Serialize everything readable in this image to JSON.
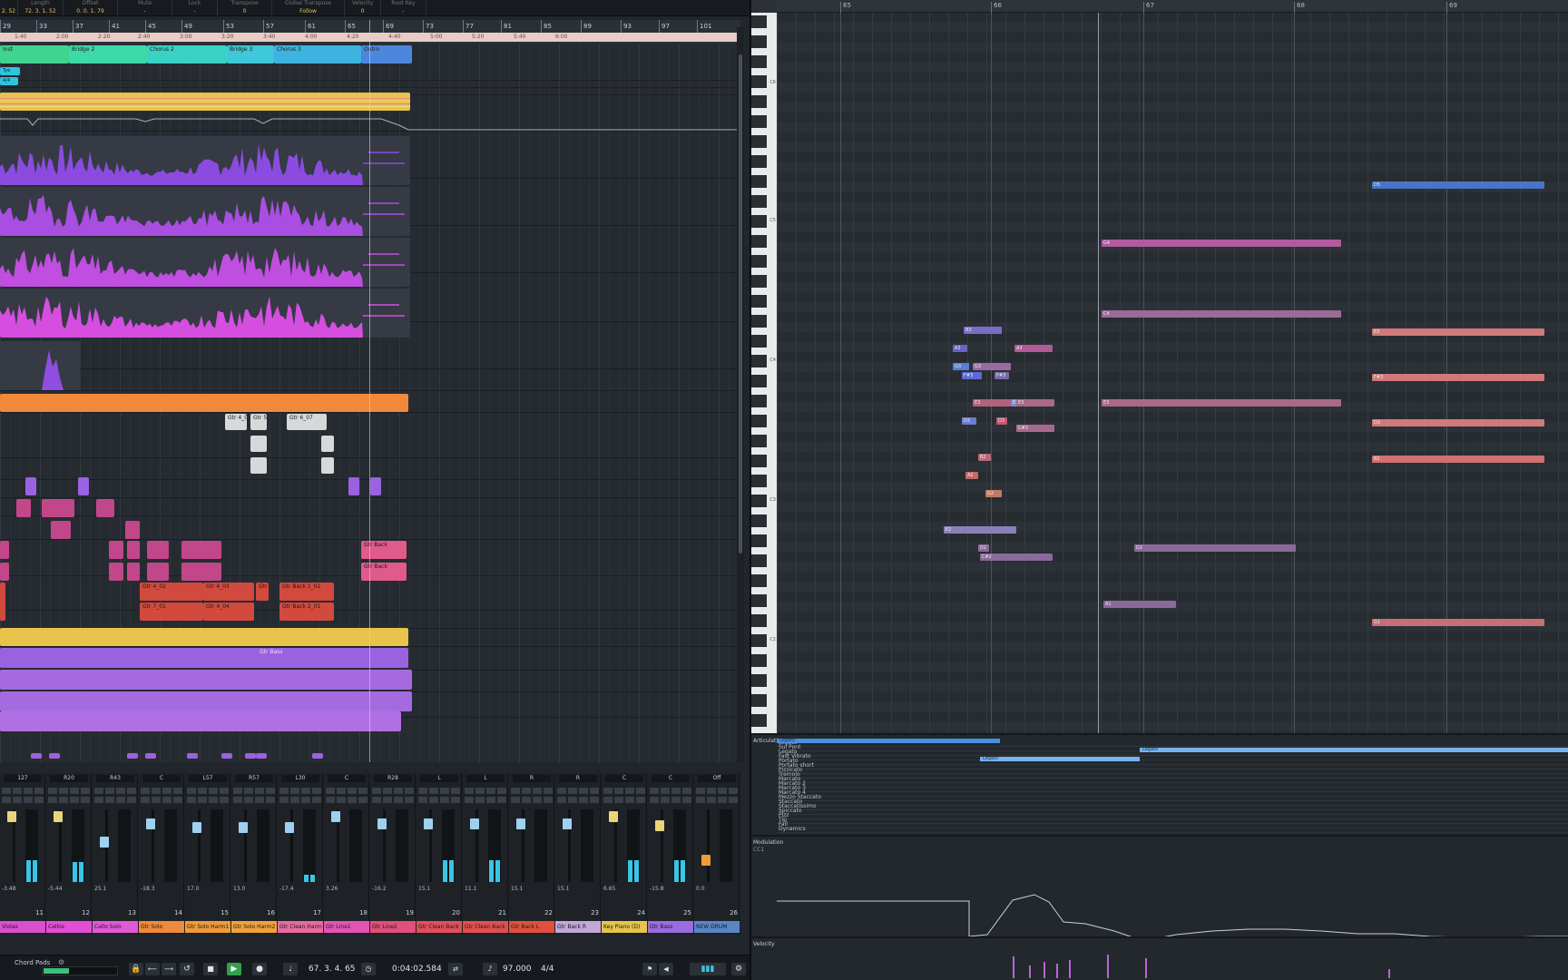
{
  "info_line": [
    {
      "label": "",
      "value": "2. 52"
    },
    {
      "label": "Length",
      "value": "72. 3. 1. 52"
    },
    {
      "label": "Offset",
      "value": "0. 0. 1. 79"
    },
    {
      "label": "Mute",
      "value": "-"
    },
    {
      "label": "Lock",
      "value": "-"
    },
    {
      "label": "Transpose",
      "value": "0"
    },
    {
      "label": "Global Transpose",
      "value": "Follow"
    },
    {
      "label": "Velocity",
      "value": "0"
    },
    {
      "label": "Root Key",
      "value": "-"
    }
  ],
  "ruler": {
    "bars": [
      "29",
      "33",
      "37",
      "41",
      "45",
      "49",
      "53",
      "57",
      "61",
      "65",
      "69",
      "73",
      "77",
      "81",
      "85",
      "89",
      "93",
      "97",
      "101"
    ],
    "times": [
      "1:40",
      "2:00",
      "2:20",
      "2:40",
      "3:00",
      "3:20",
      "3:40",
      "4:00",
      "4:20",
      "4:40",
      "5:00",
      "5:20",
      "5:40",
      "6:00"
    ]
  },
  "markers": [
    {
      "label": "Inst",
      "color": "#3fd58e"
    },
    {
      "label": "Bridge 2",
      "color": "#3dd9a7"
    },
    {
      "label": "Chorus 2",
      "color": "#39d2c4"
    },
    {
      "label": "Bridge 3",
      "color": "#3ec8d9"
    },
    {
      "label": "Chorus 3",
      "color": "#3eb3e0"
    },
    {
      "label": "Outro",
      "color": "#4d86dd"
    }
  ],
  "arrange_parts": {
    "small_tags": [
      "Tye",
      "4/4"
    ],
    "guitar_parts": [
      "Gtr 4_01",
      "Gtr 5",
      "Gtr 6_07"
    ],
    "pink_parts": [
      "Gtr Back",
      "Gtr Back"
    ],
    "red_parts": [
      "Gtr 4_02",
      "Gtr 4_03",
      "Gtr",
      "Gtr Back 1_02",
      "Gtr 7_01",
      "Gtr 4_04",
      "Gtr Back 2_01"
    ],
    "bass_label": "Gtr Bass"
  },
  "mixer": {
    "gains": [
      "127",
      "R20",
      "R43",
      "C",
      "L57",
      "R57",
      "L30",
      "C",
      "R28",
      "L",
      "L",
      "R",
      "R",
      "C",
      "C",
      "Off"
    ],
    "db_values": [
      "-3.48",
      "-5.44",
      "25.1",
      "-18.3",
      "17.0",
      "13.0",
      "-17.4",
      "3.26",
      "-16.2",
      "15.1",
      "11.1",
      "15.1",
      "15.1",
      "6.65",
      "-15.8",
      "0.0"
    ],
    "numbers": [
      "11",
      "12",
      "13",
      "14",
      "15",
      "16",
      "17",
      "18",
      "19",
      "20",
      "21",
      "22",
      "23",
      "24",
      "25",
      "26"
    ],
    "names": [
      "Violas",
      "Cellos",
      "Cello Solo",
      "Gtr Solo",
      "Gtr Solo Harm1",
      "Gtr Solo Harm2",
      "Gtr Clean Harm",
      "Gtr Line1",
      "Gtr Line2",
      "Gtr Clean Back",
      "Gtr Clean Back",
      "Gtr Back L",
      "Gtr Back R",
      "Key Piano (D)",
      "Gtr Bass",
      "NEW DRUM"
    ],
    "colors": [
      "#d94fd0",
      "#e24fd6",
      "#e158d8",
      "#ef8a3a",
      "#f09a38",
      "#f0a13a",
      "#e76ba0",
      "#e455b3",
      "#e14f7a",
      "#e14f5a",
      "#e24f4f",
      "#e1503c",
      "#c0a8d8",
      "#e8c44a",
      "#9b6ce0",
      "#5a86c8"
    ]
  },
  "transport": {
    "preset": "Chord Pads",
    "position": "67. 3. 4. 65",
    "time": "0:04:02.584",
    "tempo": "97.000",
    "signature": "4/4"
  },
  "piano_roll": {
    "bars": [
      "65",
      "66",
      "67",
      "68",
      "69"
    ],
    "key_labels": [
      "C6",
      "C5",
      "C4",
      "C3",
      "C2"
    ],
    "notes": [
      {
        "label": "D5",
        "color": "#4a74c6"
      },
      {
        "label": "G4",
        "color": "#b15a9e"
      },
      {
        "label": "C4",
        "color": "#9a6b98"
      },
      {
        "label": "B3",
        "color": "#7a6cc8"
      },
      {
        "label": "A3",
        "color": "#6a62c0"
      },
      {
        "label": "A3",
        "color": "#b05a96"
      },
      {
        "label": "G3",
        "color": "#c45a8a"
      },
      {
        "label": "G3",
        "color": "#5a7ed6"
      },
      {
        "label": "G3",
        "color": "#9a6aa2"
      },
      {
        "label": "F#3",
        "color": "#5a6ad6"
      },
      {
        "label": "F#3",
        "color": "#7a6aa8"
      },
      {
        "label": "E3",
        "color": "#c0667a"
      },
      {
        "label": "E3",
        "color": "#7a8cd0"
      },
      {
        "label": "E3",
        "color": "#b0627e"
      },
      {
        "label": "E3",
        "color": "#a86a86"
      },
      {
        "label": "E3",
        "color": "#a86a86"
      },
      {
        "label": "D3",
        "color": "#6a7ed0"
      },
      {
        "label": "D3",
        "color": "#c05a72"
      },
      {
        "label": "C#3",
        "color": "#a86a8c"
      },
      {
        "label": "B2",
        "color": "#b86a78"
      },
      {
        "label": "A2",
        "color": "#c06a6a"
      },
      {
        "label": "G2",
        "color": "#c07a6a"
      },
      {
        "label": "E2",
        "color": "#8a80b8"
      },
      {
        "label": "D2",
        "color": "#8a6a9a"
      },
      {
        "label": "C#2",
        "color": "#8a6a9a"
      },
      {
        "label": "D2",
        "color": "#8a6a9a"
      },
      {
        "label": "A1",
        "color": "#8a6a9a"
      },
      {
        "label": "E3",
        "color": "#d07a7a"
      },
      {
        "label": "F#3",
        "color": "#d0787a"
      },
      {
        "label": "D3",
        "color": "#d07a7a"
      },
      {
        "label": "B2",
        "color": "#d07070"
      },
      {
        "label": "G1",
        "color": "#c86e74"
      }
    ]
  },
  "articulations": {
    "lane_title": "Articulation",
    "items": [
      "Legato",
      "Sul Pont",
      "Legato",
      "Fast Vibrato",
      "Portato",
      "Portato short",
      "Pizzicato",
      "Tremolo",
      "Marcato",
      "Marcato 2",
      "Marcato 3",
      "Marcato 4",
      "Mezzo Staccato",
      "Staccato",
      "Staccatissimo",
      "Spiccato",
      "Pizz",
      "Tip",
      "Fall",
      "Dynamics"
    ],
    "events": [
      "Legato",
      "Legato",
      "Legato"
    ]
  },
  "lanes": {
    "modulation": "Modulation",
    "modulation_sub": "CC1",
    "velocity": "Velocity"
  }
}
